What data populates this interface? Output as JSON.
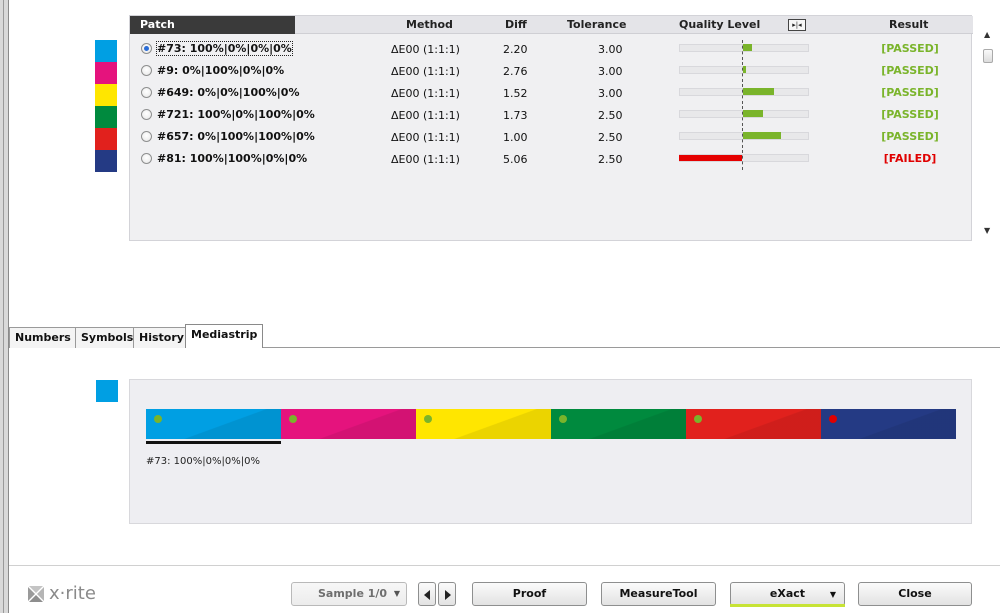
{
  "results": {
    "headers": {
      "patch": "Patch",
      "method": "Method",
      "diff": "Diff",
      "tolerance": "Tolerance",
      "quality_level": "Quality Level",
      "ql_toggle": "▸|◂",
      "result": "Result"
    },
    "rows": [
      {
        "name": "#73: 100%|0%|0%|0%",
        "method": "ΔE00 (1:1:1)",
        "diff": "2.20",
        "tolerance": "3.00",
        "quality": 0.14,
        "result": "[PASSED]",
        "status": "passed",
        "swatch": "#009fe3",
        "selected": true
      },
      {
        "name": "#9: 0%|100%|0%|0%",
        "method": "ΔE00 (1:1:1)",
        "diff": "2.76",
        "tolerance": "3.00",
        "quality": 0.04,
        "result": "[PASSED]",
        "status": "passed",
        "swatch": "#e5137d",
        "selected": false
      },
      {
        "name": "#649: 0%|0%|100%|0%",
        "method": "ΔE00 (1:1:1)",
        "diff": "1.52",
        "tolerance": "3.00",
        "quality": 0.49,
        "result": "[PASSED]",
        "status": "passed",
        "swatch": "#ffe600",
        "selected": false
      },
      {
        "name": "#721: 100%|0%|100%|0%",
        "method": "ΔE00 (1:1:1)",
        "diff": "1.73",
        "tolerance": "2.50",
        "quality": 0.31,
        "result": "[PASSED]",
        "status": "passed",
        "swatch": "#008a3e",
        "selected": false
      },
      {
        "name": "#657: 0%|100%|100%|0%",
        "method": "ΔE00 (1:1:1)",
        "diff": "1.00",
        "tolerance": "2.50",
        "quality": 0.6,
        "result": "[PASSED]",
        "status": "passed",
        "swatch": "#e1211d",
        "selected": false
      },
      {
        "name": "#81: 100%|100%|0%|0%",
        "method": "ΔE00 (1:1:1)",
        "diff": "5.06",
        "tolerance": "2.50",
        "quality": -1.0,
        "result": "[FAILED]",
        "status": "failed",
        "swatch": "#243a84",
        "selected": false
      }
    ]
  },
  "tabs": [
    {
      "label": "Numbers",
      "active": false
    },
    {
      "label": "Symbols",
      "active": false
    },
    {
      "label": "History",
      "active": false
    },
    {
      "label": "Mediastrip",
      "active": true
    }
  ],
  "mediastrip": {
    "selected_label": "#73: 100%|0%|0%|0%",
    "selected_color": "#009fe3",
    "segments": [
      {
        "color": "#009fe3",
        "dot": "#7ab42b"
      },
      {
        "color": "#e5137d",
        "dot": "#7ab42b"
      },
      {
        "color": "#ffe600",
        "dot": "#7ab42b"
      },
      {
        "color": "#008a3e",
        "dot": "#7ab42b"
      },
      {
        "color": "#e1211d",
        "dot": "#7ab42b"
      },
      {
        "color": "#243a84",
        "dot": "#e00000"
      }
    ]
  },
  "footer": {
    "logo_text": "x·rite",
    "sample_label": "Sample 1/0",
    "proof_label": "Proof",
    "measuretool_label": "MeasureTool",
    "exact_label": "eXact",
    "close_label": "Close"
  },
  "colors": {
    "passed": "#7ab42b",
    "failed": "#e00000",
    "bar_passed": "#7ab42b",
    "bar_failed": "#e50000"
  }
}
